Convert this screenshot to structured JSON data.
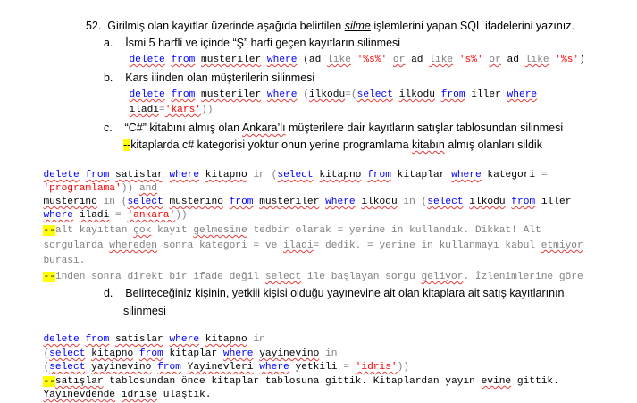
{
  "q52": {
    "num": "52.",
    "pre": "Girilmiş olan kayıtlar üzerinde aşağıda belirtilen ",
    "em": "silme",
    "post": " işlemlerini yapan SQL ifadelerini yazınız."
  },
  "a": {
    "marker": "a.",
    "text": "İsmi 5 harfli ve içinde “Ş” harfi geçen kayıtların silinmesi",
    "code": {
      "delete": "delete",
      "from": "from",
      "table": "musteriler",
      "where": "where",
      "open": "(ad ",
      "like1": "like",
      "s1": "'%s%'",
      "or1": "or",
      "ad2": "ad",
      "like2": "like",
      "s2": "'s%'",
      "or2": "or",
      "ad3": "ad",
      "like3": "like",
      "s3": "'%s'",
      "close": ")"
    }
  },
  "b": {
    "marker": "b.",
    "text": "Kars ilinden olan müşterilerin silinmesi",
    "code1": {
      "delete": "delete",
      "from": "from",
      "table": "musteriler",
      "where": "where",
      "open": "(",
      "ilkodu": "ilkodu",
      "eq": "=(",
      "select": "select",
      "ilkodu2": "ilkodu",
      "from2": "from",
      "iller": "iller",
      "where2": "where"
    },
    "code2": {
      "iladi": "iladi",
      "eq": "=",
      "s": "'kars'",
      "close": "))"
    }
  },
  "c": {
    "marker": "c.",
    "text_pre": "“C#” kitabını almış olan ",
    "text_sq": "Ankara’lı",
    "text_post": " müşterilere dair kayıtların satışlar tablosundan silinmesi",
    "note_dash": "--",
    "note_pre": "kitaplarda c# kategorisi yoktur onun yerine programlama ",
    "note_sq": "kitabın",
    "note_post": " almış olanları sildik"
  },
  "block1": {
    "l1": {
      "delete": "delete",
      "from": "from",
      "satislar": "satislar",
      "where": "where",
      "kitapno": "kitapno",
      "in": "in",
      "open": "(",
      "select": "select",
      "kitapno2": "kitapno",
      "from2": "from",
      "kitaplar": "kitaplar",
      "where2": "where",
      "kategori": "kategori",
      "eq": "="
    },
    "l2": {
      "s": "'programlama'",
      "close": "))",
      "and": "and"
    },
    "l3": {
      "musterino": "musterino",
      "in": "in",
      "open": "(",
      "select": "select",
      "musterino2": "musterino",
      "from": "from",
      "musteriler": "musteriler",
      "where": "where",
      "ilkodu": "ilkodu",
      "in2": "in",
      "open2": "(",
      "select2": "select",
      "ilkodu2": "ilkodu",
      "from2": "from",
      "iller": "iller"
    },
    "l4": {
      "where": "where",
      "iladi": "iladi",
      "eq": "=",
      "s": "'ankara'",
      "close": "))"
    },
    "c1": {
      "dash": "--",
      "pre": "alt kayıttan ",
      "cok": "çok",
      "mid": " kayıt ",
      "gelmesine": "gelmesine",
      "post": " tedbir olarak = yerine in kullandık. Dikkat! Alt"
    },
    "c2": {
      "pre": "sorgularda ",
      "whereden": "whereden",
      "mid1": " sonra kategori = ve ",
      "iladi": "iladi",
      "mid2": "= dedik. = yerine in kullanmayı kabul ",
      "etmiyor": "etmiyor"
    },
    "c3": {
      "text": "burası."
    },
    "c4": {
      "dash": "--",
      "pre": "inden sonra direkt bir ifade değil ",
      "select": "select",
      "mid": " ile başlayan sorgu ",
      "geliyor": "geliyor",
      "post": ". İzlenimlerine göre"
    }
  },
  "d": {
    "marker": "d.",
    "line1": "Belirteceğiniz kişinin, yetkili kişisi olduğu yayınevine ait olan kitaplara ait satış kayıtlarının",
    "line2": "silinmesi"
  },
  "block2": {
    "l1": {
      "delete": "delete",
      "from": "from",
      "satislar": "satislar",
      "where": "where",
      "kitapno": "kitapno",
      "in": "in"
    },
    "l2": {
      "open": "(",
      "select": "select",
      "kitapno": "kitapno",
      "from": "from",
      "kitaplar": "kitaplar",
      "where": "where",
      "yayinevino": "yayinevino",
      "in": "in"
    },
    "l3": {
      "open": "(",
      "select": "select",
      "yayinevino": "yayinevino",
      "from": "from",
      "table": "Yayinevleri",
      "where": "where",
      "yetkili": "yetkili",
      "eq": "=",
      "s": "'idris'",
      "close": "))"
    },
    "c1": {
      "dash": "--",
      "satislar": "satışlar",
      "mid": " tablosundan önce kitaplar tablosuna gittik. Kitaplardan yayın ",
      "evine": "evine",
      "post": " gittik."
    },
    "c2": {
      "yayinevden": "Yayınevdende",
      "mid": " ",
      "idrise": "idrise",
      "post": " ulaştık."
    }
  },
  "colors": {
    "keyword": "#0000ff",
    "string": "#ff0000",
    "comment": "#008000",
    "operator": "#808080",
    "highlight": "#ffff00"
  }
}
